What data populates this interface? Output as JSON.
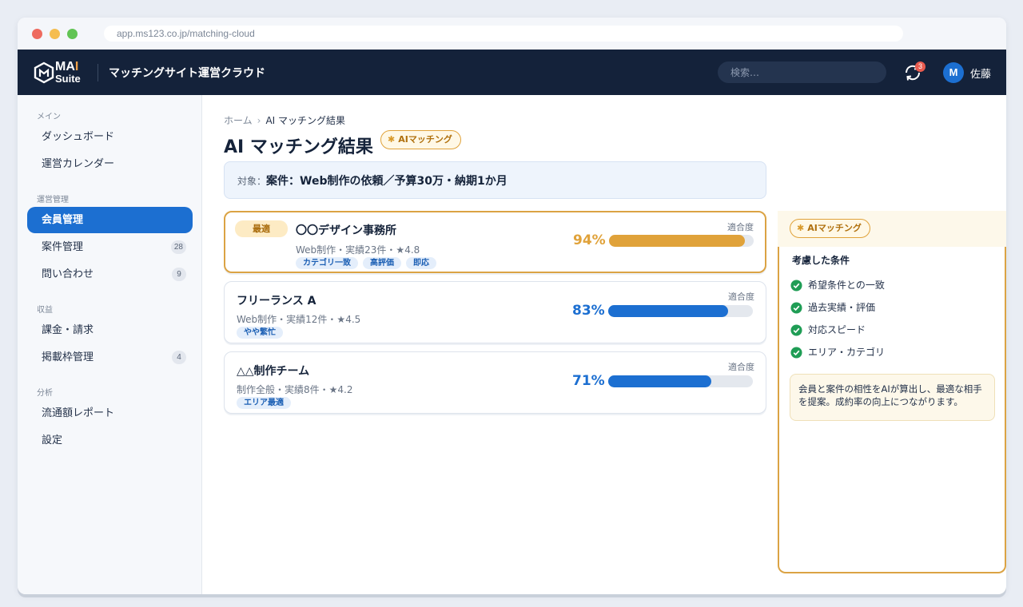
{
  "browser": {
    "url": "app.ms123.co.jp/matching-cloud"
  },
  "header": {
    "logo_ma": "MA",
    "logo_ai": "I",
    "logo_suite": "Suite",
    "app_title": "マッチングサイト運営クラウド",
    "search_placeholder": "検索…",
    "notification_count": "3",
    "avatar_initial": "M",
    "user_name": "佐藤"
  },
  "sidebar": {
    "sections": [
      {
        "label": "メイン",
        "items": [
          {
            "label": "ダッシュボード"
          },
          {
            "label": "運営カレンダー"
          }
        ]
      },
      {
        "label": "運営管理",
        "items": [
          {
            "label": "会員管理",
            "active": true
          },
          {
            "label": "案件管理",
            "count": "28"
          },
          {
            "label": "問い合わせ",
            "count": "9"
          }
        ]
      },
      {
        "label": "収益",
        "items": [
          {
            "label": "課金・請求"
          },
          {
            "label": "掲載枠管理",
            "count": "4"
          }
        ]
      },
      {
        "label": "分析",
        "items": [
          {
            "label": "流通額レポート"
          },
          {
            "label": "設定"
          }
        ]
      }
    ]
  },
  "breadcrumb": {
    "home": "ホーム",
    "sep": "›",
    "current": "AI マッチング結果"
  },
  "page": {
    "title": "AI マッチング結果",
    "ai_badge": "AIマッチング",
    "target_label": "対象：",
    "target_value": "案件：Web制作の依頼／予算30万・納期1か月"
  },
  "fit_label": "適合度",
  "results": [
    {
      "badge": "最適",
      "name": "〇〇デザイン事務所",
      "meta": "Web制作・実績23件・★4.8",
      "tags": [
        "カテゴリ一致",
        "高評価",
        "即応"
      ],
      "score": 94,
      "score_text": "94%",
      "color": "#e0a23a"
    },
    {
      "name": "フリーランス A",
      "meta": "Web制作・実績12件・★4.5",
      "tags": [
        "やや繁忙"
      ],
      "score": 83,
      "score_text": "83%",
      "color": "#1c6fd1"
    },
    {
      "name": "△△制作チーム",
      "meta": "制作全般・実績8件・★4.2",
      "tags": [
        "エリア最適"
      ],
      "score": 71,
      "score_text": "71%",
      "color": "#1c6fd1"
    }
  ],
  "panel": {
    "badge": "AIマッチング",
    "subtitle": "考慮した条件",
    "conditions": [
      "希望条件との一致",
      "過去実績・評価",
      "対応スピード",
      "エリア・カテゴリ"
    ],
    "note": "会員と案件の相性をAIが算出し、最適な相手を提案。成約率の向上につながります。"
  },
  "colors": {
    "accent": "#1c6fd1",
    "gold": "#e0a23a",
    "navy": "#14223a",
    "check": "#1f9d55"
  }
}
